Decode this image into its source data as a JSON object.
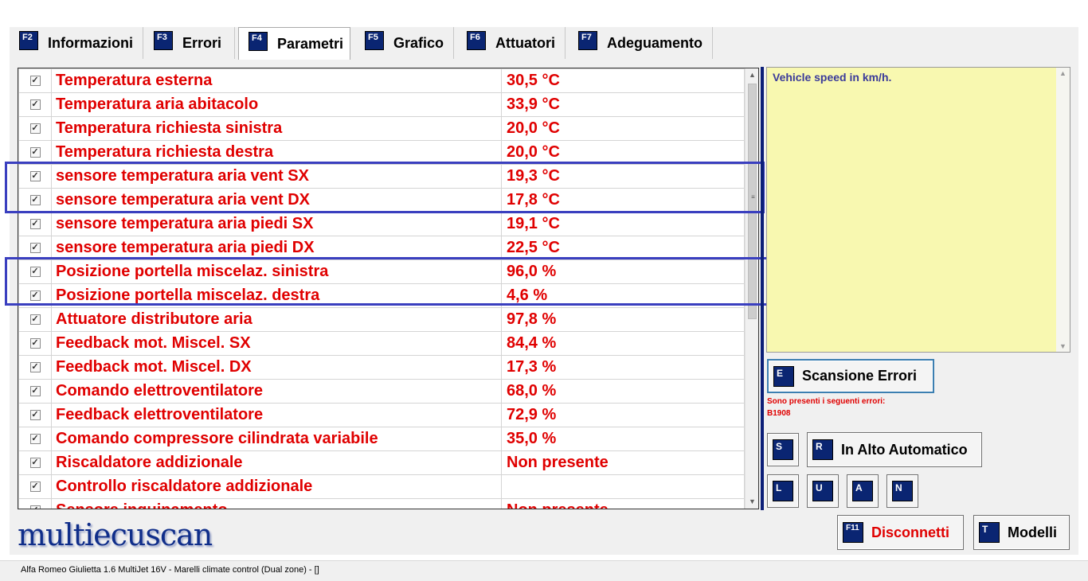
{
  "tabs": [
    {
      "key": "F2",
      "label": "Informazioni",
      "active": false
    },
    {
      "key": "F3",
      "label": "Errori",
      "active": false
    },
    {
      "key": "F4",
      "label": "Parametri",
      "active": true
    },
    {
      "key": "F5",
      "label": "Grafico",
      "active": false
    },
    {
      "key": "F6",
      "label": "Attuatori",
      "active": false
    },
    {
      "key": "F7",
      "label": "Adeguamento",
      "active": false
    }
  ],
  "parameters": [
    {
      "checked": true,
      "name": "Temperatura esterna",
      "value": "30,5 °C"
    },
    {
      "checked": true,
      "name": "Temperatura aria abitacolo",
      "value": "33,9 °C"
    },
    {
      "checked": true,
      "name": "Temperatura richiesta sinistra",
      "value": "20,0 °C"
    },
    {
      "checked": true,
      "name": "Temperatura richiesta destra",
      "value": "20,0 °C"
    },
    {
      "checked": true,
      "name": "sensore temperatura aria vent SX",
      "value": "19,3 °C"
    },
    {
      "checked": true,
      "name": "sensore temperatura aria vent DX",
      "value": "17,8 °C"
    },
    {
      "checked": true,
      "name": "sensore temperatura aria piedi SX",
      "value": "19,1 °C"
    },
    {
      "checked": true,
      "name": "sensore temperatura aria piedi DX",
      "value": "22,5 °C"
    },
    {
      "checked": true,
      "name": "Posizione portella miscelaz. sinistra",
      "value": "96,0 %"
    },
    {
      "checked": true,
      "name": "Posizione portella miscelaz. destra",
      "value": "4,6 %"
    },
    {
      "checked": true,
      "name": "Attuatore distributore aria",
      "value": "97,8 %"
    },
    {
      "checked": true,
      "name": "Feedback mot. Miscel. SX",
      "value": "84,4 %"
    },
    {
      "checked": true,
      "name": "Feedback mot. Miscel. DX",
      "value": "17,3 %"
    },
    {
      "checked": true,
      "name": "Comando elettroventilatore",
      "value": "68,0 %"
    },
    {
      "checked": true,
      "name": "Feedback elettroventilatore",
      "value": "72,9 %"
    },
    {
      "checked": true,
      "name": "Comando compressore cilindrata variabile",
      "value": "35,0 %"
    },
    {
      "checked": true,
      "name": "Riscaldatore addizionale",
      "value": "Non presente"
    },
    {
      "checked": true,
      "name": "Controllo riscaldatore addizionale",
      "value": ""
    },
    {
      "checked": true,
      "name": "Sensore inquinamento",
      "value": "Non presente"
    }
  ],
  "description": {
    "text": "Vehicle speed in km/h."
  },
  "scan_button": {
    "key": "E",
    "label": "Scansione Errori"
  },
  "errors": {
    "title": "Sono presenti i seguenti errori:",
    "code": "B1908"
  },
  "buttons": {
    "s_key": "S",
    "auto_key": "R",
    "auto_label": "In Alto Automatico",
    "l_key": "L",
    "u_key": "U",
    "a_key": "A",
    "n_key": "N",
    "disconnect_key": "F11",
    "disconnect_label": "Disconnetti",
    "models_key": "T",
    "models_label": "Modelli"
  },
  "logo": "multiecuscan",
  "status": "Alfa Romeo Giulietta 1.6 MultiJet 16V - Marelli climate control (Dual zone) - []",
  "colors": {
    "value_text": "#e00000",
    "key_badge": "#0a2572",
    "highlight_box": "#3a3fbf",
    "description_bg": "#f8f8b0"
  }
}
